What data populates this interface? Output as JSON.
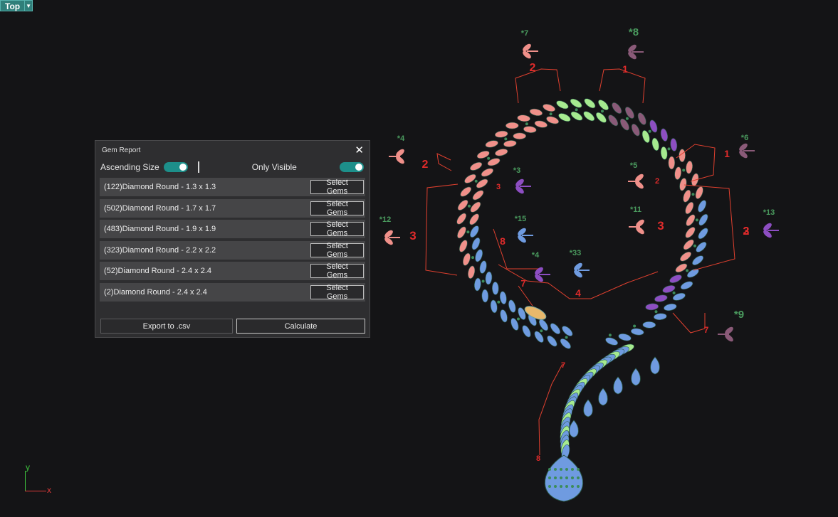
{
  "viewport": {
    "title": "Top",
    "menu_icon": "dropdown-arrow-icon"
  },
  "axes": {
    "x": "x",
    "y": "y"
  },
  "colors": {
    "panel_bg": "#2e2e30",
    "row_bg": "#454547",
    "toggle_on": "#1d8f8a",
    "annotation_red": "#e02b2b",
    "label_green": "#4a9a5e",
    "gem_blue": "#6f9be0",
    "gem_salmon": "#f0908a",
    "gem_purple": "#8d4ec2",
    "gem_mauve": "#8a5a78",
    "gem_lime": "#a6ea8f"
  },
  "panel": {
    "title": "Gem Report",
    "close_icon": "close-icon",
    "ascending_label": "Ascending Size",
    "ascending_on": true,
    "only_visible_label": "Only Visible",
    "only_visible_on": true,
    "rows": [
      {
        "label": "(122)Diamond Round - 1.3 x 1.3",
        "button": "Select Gems"
      },
      {
        "label": "(502)Diamond Round - 1.7 x 1.7",
        "button": "Select Gems"
      },
      {
        "label": "(483)Diamond Round - 1.9 x 1.9",
        "button": "Select Gems"
      },
      {
        "label": "(323)Diamond Round - 2.2 x 2.2",
        "button": "Select Gems"
      },
      {
        "label": "(52)Diamond Round - 2.4 x 2.4",
        "button": "Select Gems"
      },
      {
        "label": "(2)Diamond Round - 2.4 x 2.4",
        "button": "Select Gems"
      }
    ],
    "export_label": "Export to .csv",
    "calculate_label": "Calculate"
  },
  "annotations": {
    "green": [
      "*7",
      "*8",
      "*4",
      "*6",
      "*3",
      "*5",
      "*12",
      "*15",
      "*11",
      "*13",
      "*4",
      "*33",
      "*9"
    ],
    "red": [
      "2",
      "1",
      "2",
      "1",
      "3",
      "2",
      "3",
      "8",
      "3",
      "3",
      "2",
      "7",
      "4",
      "7",
      "7",
      "8"
    ]
  }
}
